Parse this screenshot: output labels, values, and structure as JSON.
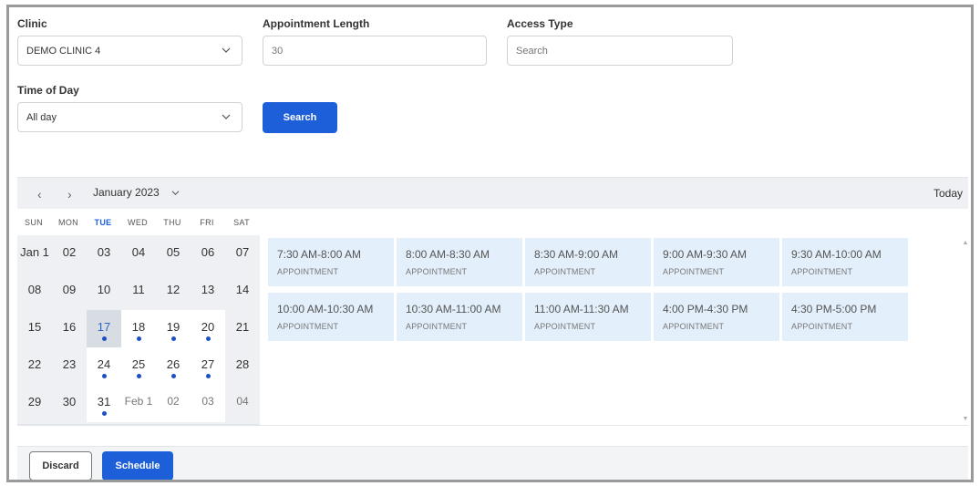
{
  "form": {
    "clinic": {
      "label": "Clinic",
      "value": "DEMO CLINIC 4"
    },
    "appointment_length": {
      "label": "Appointment Length",
      "placeholder": "30"
    },
    "access_type": {
      "label": "Access Type",
      "placeholder": "Search"
    },
    "time_of_day": {
      "label": "Time of Day",
      "value": "All day"
    },
    "search_label": "Search"
  },
  "calendar": {
    "prev_icon": "chevron-left-icon",
    "next_icon": "chevron-right-icon",
    "month_label": "January 2023",
    "today_label": "Today",
    "weekdays": [
      "SUN",
      "MON",
      "TUE",
      "WED",
      "THU",
      "FRI",
      "SAT"
    ],
    "weeks": [
      [
        "Jan 1",
        "02",
        "03",
        "04",
        "05",
        "06",
        "07"
      ],
      [
        "08",
        "09",
        "10",
        "11",
        "12",
        "13",
        "14"
      ],
      [
        "15",
        "16",
        "17",
        "18",
        "19",
        "20",
        "21"
      ],
      [
        "22",
        "23",
        "24",
        "25",
        "26",
        "27",
        "28"
      ],
      [
        "29",
        "30",
        "31",
        "Feb 1",
        "02",
        "03",
        "04"
      ]
    ],
    "accent_color": "#1d5fd9",
    "dot_color": "#1d4fc4"
  },
  "slots": [
    {
      "time": "7:30 AM-8:00 AM",
      "type": "APPOINTMENT"
    },
    {
      "time": "8:00 AM-8:30 AM",
      "type": "APPOINTMENT"
    },
    {
      "time": "8:30 AM-9:00 AM",
      "type": "APPOINTMENT"
    },
    {
      "time": "9:00 AM-9:30 AM",
      "type": "APPOINTMENT"
    },
    {
      "time": "9:30 AM-10:00 AM",
      "type": "APPOINTMENT"
    },
    {
      "time": "10:00 AM-10:30 AM",
      "type": "APPOINTMENT"
    },
    {
      "time": "10:30 AM-11:00 AM",
      "type": "APPOINTMENT"
    },
    {
      "time": "11:00 AM-11:30 AM",
      "type": "APPOINTMENT"
    },
    {
      "time": "4:00 PM-4:30 PM",
      "type": "APPOINTMENT"
    },
    {
      "time": "4:30 PM-5:00 PM",
      "type": "APPOINTMENT"
    }
  ],
  "footer": {
    "discard_label": "Discard",
    "schedule_label": "Schedule"
  }
}
